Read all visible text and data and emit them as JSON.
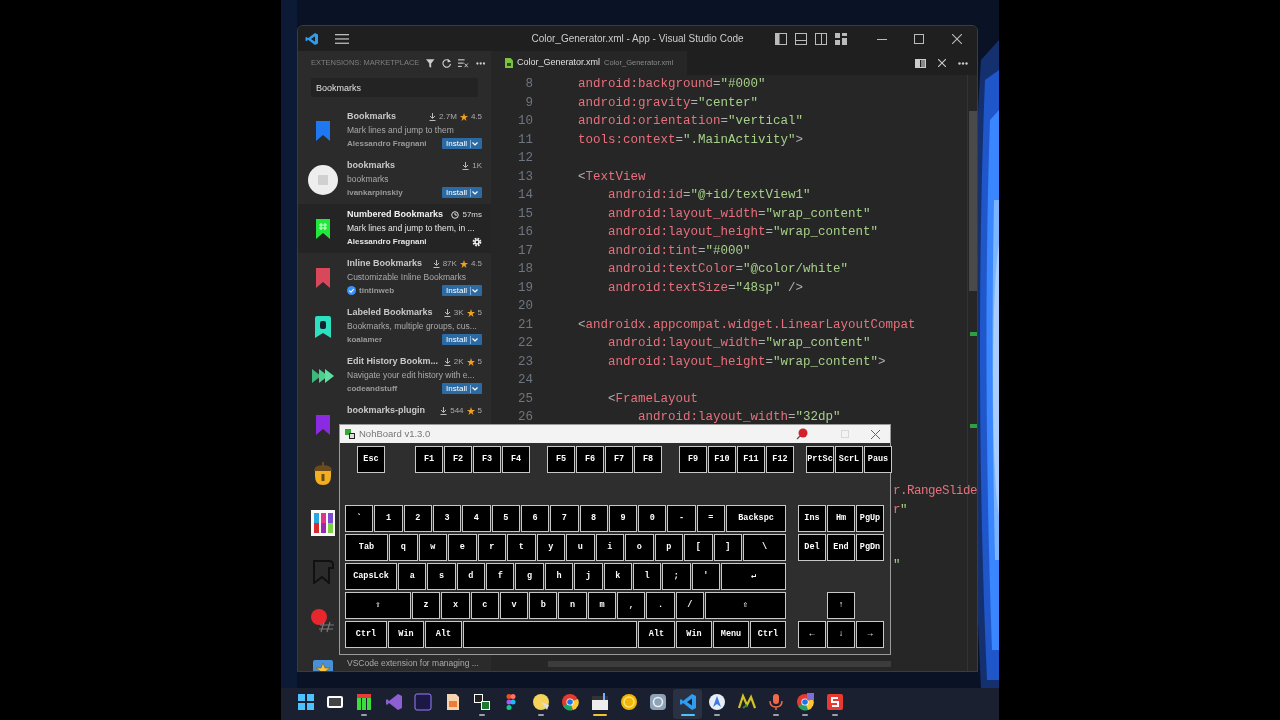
{
  "vscode": {
    "title": "Color_Generator.xml - App - Visual Studio Code",
    "sidebar": {
      "header": "EXTENSIONS: MARKETPLACE",
      "search": {
        "value": "Bookmarks"
      },
      "items": [
        {
          "name": "Bookmarks",
          "description": "Mark lines and jump to them",
          "author": "Alessandro Fragnani",
          "downloads": "2.7M",
          "rating": "4.5",
          "verified": false,
          "selected": false,
          "action": {
            "kind": "install",
            "label": "Install"
          }
        },
        {
          "name": "bookmarks",
          "description": "bookmarks",
          "author": "ivankarpinskiy",
          "downloads": "1K",
          "verified": false,
          "selected": false,
          "action": {
            "kind": "install",
            "label": "Install"
          }
        },
        {
          "name": "Numbered Bookmarks",
          "description": "Mark lines and jump to them, in ...",
          "author": "Alessandro Fragnani",
          "activation_time": "57ms",
          "verified": false,
          "selected": true,
          "action": {
            "kind": "manage"
          }
        },
        {
          "name": "Inline Bookmarks",
          "description": "Customizable Inline Bookmarks",
          "author": "tintinweb",
          "downloads": "87K",
          "rating": "4.5",
          "verified": true,
          "selected": false,
          "action": {
            "kind": "install",
            "label": "Install"
          }
        },
        {
          "name": "Labeled Bookmarks",
          "description": "Bookmarks, multiple groups, cus...",
          "author": "koalamer",
          "downloads": "3K",
          "rating": "5",
          "verified": false,
          "selected": false,
          "action": {
            "kind": "install",
            "label": "Install"
          }
        },
        {
          "name": "Edit History Bookm...",
          "description": "Navigate your edit history with e...",
          "author": "codeandstuff",
          "downloads": "2K",
          "rating": "5",
          "verified": false,
          "selected": false,
          "action": {
            "kind": "install",
            "label": "Install"
          }
        },
        {
          "name": "bookmarks-plugin",
          "downloads": "544",
          "rating": "5",
          "verified": false,
          "selected": false
        }
      ],
      "partly_hidden_item": {
        "description": "VSCode extension for managing ..."
      }
    },
    "tab": {
      "label": "Color_Generator.xml",
      "description": "Color_Generator.xml"
    },
    "code_lines": [
      {
        "number": "8",
        "tokens": [
          {
            "kind": "attr",
            "text": "    android:background"
          },
          {
            "kind": "punct",
            "text": "="
          },
          {
            "kind": "str",
            "text": "\"#000\""
          }
        ]
      },
      {
        "number": "9",
        "tokens": [
          {
            "kind": "attr",
            "text": "    android:gravity"
          },
          {
            "kind": "punct",
            "text": "="
          },
          {
            "kind": "str",
            "text": "\"center\""
          }
        ]
      },
      {
        "number": "10",
        "tokens": [
          {
            "kind": "attr",
            "text": "    android:orientation"
          },
          {
            "kind": "punct",
            "text": "="
          },
          {
            "kind": "str",
            "text": "\"vertical\""
          }
        ]
      },
      {
        "number": "11",
        "tokens": [
          {
            "kind": "attr",
            "text": "    tools:context"
          },
          {
            "kind": "punct",
            "text": "="
          },
          {
            "kind": "str",
            "text": "\".MainActivity\""
          },
          {
            "kind": "punct",
            "text": ">"
          }
        ]
      },
      {
        "number": "12"
      },
      {
        "number": "13",
        "tokens": [
          {
            "kind": "punct",
            "text": "    <"
          },
          {
            "kind": "tag",
            "text": "TextView"
          }
        ]
      },
      {
        "number": "14",
        "tokens": [
          {
            "kind": "attr",
            "text": "        android:id"
          },
          {
            "kind": "punct",
            "text": "="
          },
          {
            "kind": "str",
            "text": "\"@+id/textView1\""
          }
        ]
      },
      {
        "number": "15",
        "tokens": [
          {
            "kind": "attr",
            "text": "        android:layout_width"
          },
          {
            "kind": "punct",
            "text": "="
          },
          {
            "kind": "str",
            "text": "\"wrap_content\""
          }
        ]
      },
      {
        "number": "16",
        "tokens": [
          {
            "kind": "attr",
            "text": "        android:layout_height"
          },
          {
            "kind": "punct",
            "text": "="
          },
          {
            "kind": "str",
            "text": "\"wrap_content\""
          }
        ]
      },
      {
        "number": "17",
        "tokens": [
          {
            "kind": "attr",
            "text": "        android:tint"
          },
          {
            "kind": "punct",
            "text": "="
          },
          {
            "kind": "str",
            "text": "\"#000\""
          }
        ]
      },
      {
        "number": "18",
        "tokens": [
          {
            "kind": "attr",
            "text": "        android:textColor"
          },
          {
            "kind": "punct",
            "text": "="
          },
          {
            "kind": "str",
            "text": "\"@color/white\""
          }
        ]
      },
      {
        "number": "19",
        "tokens": [
          {
            "kind": "attr",
            "text": "        android:textSize"
          },
          {
            "kind": "punct",
            "text": "="
          },
          {
            "kind": "str",
            "text": "\"48sp\""
          },
          {
            "kind": "punct",
            "text": " />"
          }
        ]
      },
      {
        "number": "20"
      },
      {
        "number": "21",
        "tokens": [
          {
            "kind": "punct",
            "text": "    <"
          },
          {
            "kind": "tag",
            "text": "androidx.appcompat.widget.LinearLayoutCompat"
          }
        ]
      },
      {
        "number": "22",
        "tokens": [
          {
            "kind": "attr",
            "text": "        android:layout_width"
          },
          {
            "kind": "punct",
            "text": "="
          },
          {
            "kind": "str",
            "text": "\"wrap_content\""
          }
        ]
      },
      {
        "number": "23",
        "tokens": [
          {
            "kind": "attr",
            "text": "        android:layout_height"
          },
          {
            "kind": "punct",
            "text": "="
          },
          {
            "kind": "str",
            "text": "\"wrap_content\""
          },
          {
            "kind": "punct",
            "text": ">"
          }
        ]
      },
      {
        "number": "24"
      },
      {
        "number": "25",
        "tokens": [
          {
            "kind": "punct",
            "text": "        <"
          },
          {
            "kind": "tag",
            "text": "FrameLayout"
          }
        ]
      },
      {
        "number": "26",
        "tokens": [
          {
            "kind": "attr",
            "text": "            android:layout_width"
          },
          {
            "kind": "punct",
            "text": "="
          },
          {
            "kind": "str",
            "text": "\"32dp\""
          }
        ]
      }
    ],
    "code_fragments_right_of_overlay": [
      {
        "tokens": [
          {
            "kind": "tag",
            "text": "r.RangeSlide"
          }
        ]
      },
      {
        "tokens": [
          {
            "kind": "attr",
            "text": "r"
          },
          {
            "kind": "str",
            "text": "\""
          }
        ]
      },
      {
        "tokens": [
          {
            "kind": "str",
            "text": "\""
          }
        ]
      }
    ]
  },
  "keyboard": {
    "title": "NohBoard v1.3.0",
    "function_row": [
      [
        "Esc"
      ],
      [
        "F1",
        "F2",
        "F3",
        "F4"
      ],
      [
        "F5",
        "F6",
        "F7",
        "F8"
      ],
      [
        "F9",
        "F10",
        "F11",
        "F12"
      ],
      [
        "PrtSc",
        "ScrL",
        "Paus"
      ]
    ],
    "main_rows": [
      [
        {
          "label": "`",
          "kind": "std"
        },
        {
          "label": "1",
          "kind": "std"
        },
        {
          "label": "2",
          "kind": "std"
        },
        {
          "label": "3",
          "kind": "std"
        },
        {
          "label": "4",
          "kind": "std"
        },
        {
          "label": "5",
          "kind": "std"
        },
        {
          "label": "6",
          "kind": "std"
        },
        {
          "label": "7",
          "kind": "std"
        },
        {
          "label": "8",
          "kind": "std"
        },
        {
          "label": "9",
          "kind": "std"
        },
        {
          "label": "0",
          "kind": "std"
        },
        {
          "label": "-",
          "kind": "std"
        },
        {
          "label": "=",
          "kind": "std"
        },
        {
          "label": "Backspc",
          "kind": "backspace"
        }
      ],
      [
        {
          "label": "Tab",
          "kind": "tab"
        },
        {
          "label": "q",
          "kind": "std"
        },
        {
          "label": "w",
          "kind": "std"
        },
        {
          "label": "e",
          "kind": "std"
        },
        {
          "label": "r",
          "kind": "std"
        },
        {
          "label": "t",
          "kind": "std"
        },
        {
          "label": "y",
          "kind": "std"
        },
        {
          "label": "u",
          "kind": "std"
        },
        {
          "label": "i",
          "kind": "std"
        },
        {
          "label": "o",
          "kind": "std"
        },
        {
          "label": "p",
          "kind": "std"
        },
        {
          "label": "[",
          "kind": "std"
        },
        {
          "label": "]",
          "kind": "std"
        },
        {
          "label": "\\",
          "kind": "backslash"
        }
      ],
      [
        {
          "label": "CapsLck",
          "kind": "caps"
        },
        {
          "label": "a",
          "kind": "std"
        },
        {
          "label": "s",
          "kind": "std"
        },
        {
          "label": "d",
          "kind": "std"
        },
        {
          "label": "f",
          "kind": "std"
        },
        {
          "label": "g",
          "kind": "std"
        },
        {
          "label": "h",
          "kind": "std"
        },
        {
          "label": "j",
          "kind": "std"
        },
        {
          "label": "k",
          "kind": "std"
        },
        {
          "label": "l",
          "kind": "std"
        },
        {
          "label": ";",
          "kind": "std"
        },
        {
          "label": "'",
          "kind": "std"
        },
        {
          "label": "↵",
          "kind": "enter"
        }
      ],
      [
        {
          "label": "⇧",
          "kind": "lshift"
        },
        {
          "label": "z",
          "kind": "std"
        },
        {
          "label": "x",
          "kind": "std"
        },
        {
          "label": "c",
          "kind": "std"
        },
        {
          "label": "v",
          "kind": "std"
        },
        {
          "label": "b",
          "kind": "std"
        },
        {
          "label": "n",
          "kind": "std"
        },
        {
          "label": "m",
          "kind": "std"
        },
        {
          "label": ",",
          "kind": "std"
        },
        {
          "label": ".",
          "kind": "std"
        },
        {
          "label": "/",
          "kind": "std"
        },
        {
          "label": "⇧",
          "kind": "rshift"
        }
      ],
      [
        {
          "label": "Ctrl",
          "kind": "ctrl"
        },
        {
          "label": "Win",
          "kind": "win"
        },
        {
          "label": "Alt",
          "kind": "alt"
        },
        {
          "kind": "space"
        },
        {
          "label": "Alt",
          "kind": "alt"
        },
        {
          "label": "Win",
          "kind": "win"
        },
        {
          "label": "Menu",
          "kind": "win"
        },
        {
          "label": "Ctrl",
          "kind": "win"
        }
      ]
    ],
    "nav_rows": [
      [
        "Ins",
        "Hm",
        "PgUp"
      ],
      [
        "Del",
        "End",
        "PgDn"
      ]
    ],
    "arrow_rows": [
      [
        "↑"
      ],
      [
        "←",
        "↓",
        "→"
      ]
    ]
  }
}
